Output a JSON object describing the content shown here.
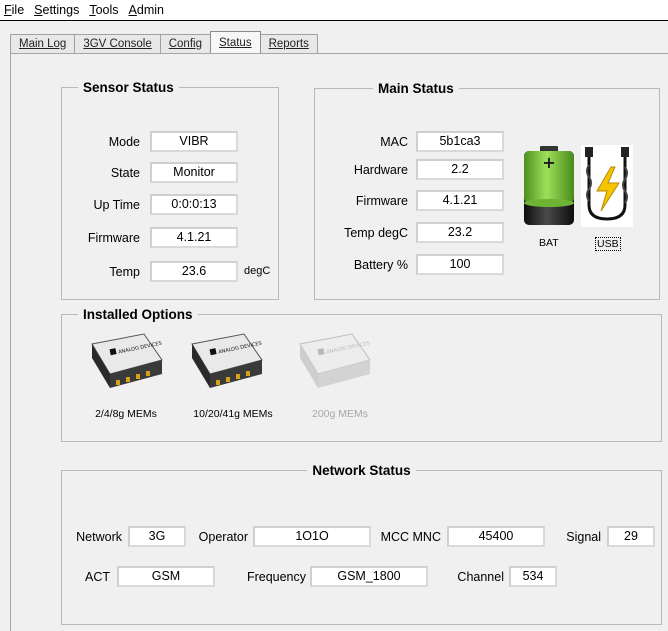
{
  "menu": [
    {
      "label": "File",
      "accel": "F"
    },
    {
      "label": "Settings",
      "accel": "S"
    },
    {
      "label": "Tools",
      "accel": "T"
    },
    {
      "label": "Admin",
      "accel": "A"
    }
  ],
  "tabs": {
    "main_log": "Main Log",
    "console": "3GV Console",
    "config": "Config",
    "status": "Status",
    "reports": "Reports"
  },
  "sensor_status": {
    "title": "Sensor Status",
    "mode_label": "Mode",
    "mode": "VIBR",
    "state_label": "State",
    "state": "Monitor",
    "uptime_label": "Up Time",
    "uptime": "0:0:0:13",
    "firmware_label": "Firmware",
    "firmware": "4.1.21",
    "temp_label": "Temp",
    "temp": "23.6",
    "temp_unit": "degC"
  },
  "main_status": {
    "title": "Main Status",
    "mac_label": "MAC",
    "mac": "5b1ca3",
    "hardware_label": "Hardware",
    "hardware": "2.2",
    "firmware_label": "Firmware",
    "firmware": "4.1.21",
    "temp_label": "Temp degC",
    "temp": "23.2",
    "battery_label": "Battery %",
    "battery": "100",
    "bat_caption": "BAT",
    "usb_caption": "USB",
    "battery_icon": "battery-icon",
    "usb_icon": "usb-charging-icon",
    "battery_level": 0.7
  },
  "installed_options": {
    "title": "Installed Options",
    "chip_logo_text": "ANALOG DEVICES",
    "options": [
      {
        "label": "2/4/8g MEMs",
        "enabled": true
      },
      {
        "label": "10/20/41g MEMs",
        "enabled": true
      },
      {
        "label": "200g MEMs",
        "enabled": false
      }
    ]
  },
  "network_status": {
    "title": "Network Status",
    "network_label": "Network",
    "network": "3G",
    "operator_label": "Operator",
    "operator": "1O1O",
    "mcc_label": "MCC MNC",
    "mcc": "45400",
    "signal_label": "Signal",
    "signal": "29",
    "act_label": "ACT",
    "act": "GSM",
    "frequency_label": "Frequency",
    "frequency": "GSM_1800",
    "channel_label": "Channel",
    "channel": "534"
  },
  "colors": {
    "battery_green": "#7ac943",
    "battery_dark": "#1a1a1a",
    "bolt": "#f5c400"
  }
}
